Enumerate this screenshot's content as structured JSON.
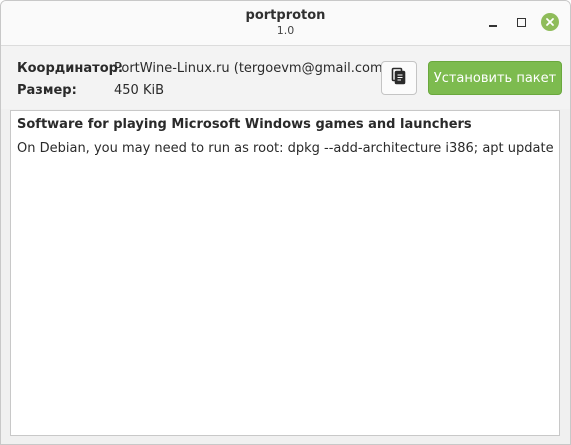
{
  "window": {
    "title": "portproton",
    "subtitle": "1.0"
  },
  "titlebar_buttons": {
    "minimize_icon": "minimize-icon",
    "maximize_icon": "maximize-icon",
    "close_icon": "close-icon",
    "close_color": "#8fbc5a"
  },
  "info": {
    "maintainer_label": "Координатор:",
    "maintainer_value": "PortWine-Linux.ru (tergoevm@gmail.com)",
    "size_label": "Размер:",
    "size_value": "450 KiB"
  },
  "actions": {
    "copy_icon": "copy-details-icon",
    "install_label": "Установить пакет",
    "install_color": "#7dbb4f"
  },
  "description": {
    "title": "Software for playing Microsoft Windows games and launchers",
    "body": "On Debian, you may need to run as root: dpkg --add-architecture i386; apt update"
  }
}
